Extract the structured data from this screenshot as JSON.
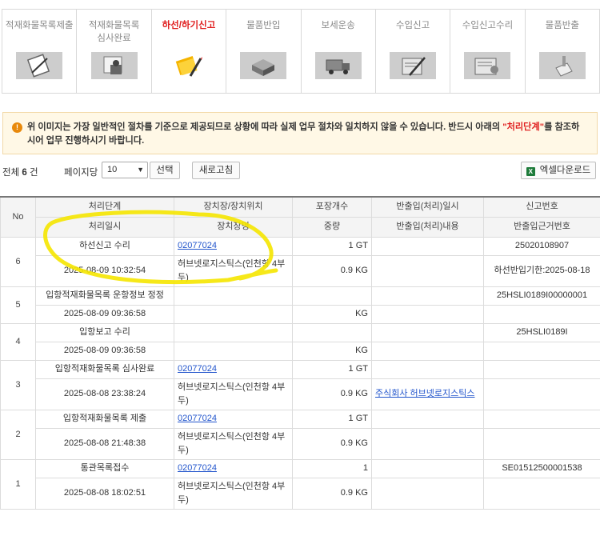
{
  "steps": [
    {
      "label": "적재화물목록제출",
      "icon": "clipboard-pen-icon",
      "active": false
    },
    {
      "label": "적재화물목록\n심사완료",
      "icon": "stamp-document-icon",
      "active": false
    },
    {
      "label": "하선/하기신고",
      "icon": "folder-pencil-icon",
      "active": true
    },
    {
      "label": "물품반입",
      "icon": "boxes-icon",
      "active": false
    },
    {
      "label": "보세운송",
      "icon": "truck-icon",
      "active": false
    },
    {
      "label": "수입신고",
      "icon": "form-pen-icon",
      "active": false
    },
    {
      "label": "수입신고수리",
      "icon": "stamped-form-icon",
      "active": false
    },
    {
      "label": "물품반출",
      "icon": "outgoing-item-icon",
      "active": false
    }
  ],
  "notice": {
    "icon": "exclamation-icon",
    "text_before": "위 이미지는 가장 일반적인 절차를 기준으로 제공되므로 상황에 따라 실제 업무 절차와 일치하지 않을 수 있습니다. 반드시 아래의 ",
    "highlight": "\"처리단계\"",
    "text_after": "를 참조하시어 업무 진행하시기 바랍니다."
  },
  "toolbar": {
    "total_prefix": "전체",
    "total_count": "6",
    "total_suffix": "건",
    "per_page_label": "페이지당",
    "per_page_value": "10",
    "select_label": "선택",
    "refresh_label": "새로고침",
    "excel_label": "엑셀다운로드",
    "excel_icon": "excel-icon"
  },
  "table": {
    "headers": {
      "no": "No",
      "row1": [
        "처리단계",
        "장치장/장치위치",
        "포장개수",
        "반출입(처리)일시",
        "신고번호"
      ],
      "row2": [
        "처리일시",
        "장치장명",
        "중량",
        "반출입(처리)내용",
        "반출입근거번호"
      ]
    },
    "rows": [
      {
        "no": "6",
        "step": "하선신고 수리",
        "location": "02077024",
        "pkg": "1 GT",
        "inout_time": "",
        "decl_no": "25020108907",
        "time": "2025-08-09 10:32:54",
        "location_name": "허브넷로지스틱스(인천항 4부두)",
        "weight": "0.9 KG",
        "inout_content": "",
        "basis_no": "하선반입기한:2025-08-18"
      },
      {
        "no": "5",
        "step": "입항적재화물목록 운항정보 정정",
        "location": "",
        "pkg": "",
        "inout_time": "",
        "decl_no": "25HSLI0189I00000001",
        "time": "2025-08-09 09:36:58",
        "location_name": "",
        "weight": "KG",
        "inout_content": "",
        "basis_no": ""
      },
      {
        "no": "4",
        "step": "입항보고 수리",
        "location": "",
        "pkg": "",
        "inout_time": "",
        "decl_no": "25HSLI0189I",
        "time": "2025-08-09 09:36:58",
        "location_name": "",
        "weight": "KG",
        "inout_content": "",
        "basis_no": ""
      },
      {
        "no": "3",
        "step": "입항적재화물목록 심사완료",
        "location": "02077024",
        "pkg": "1 GT",
        "inout_time": "",
        "decl_no": "",
        "time": "2025-08-08 23:38:24",
        "location_name": "허브넷로지스틱스(인천항 4부두)",
        "weight": "0.9 KG",
        "inout_content": "주식회사 허브넷로지스틱스",
        "basis_no": ""
      },
      {
        "no": "2",
        "step": "입항적재화물목록 제출",
        "location": "02077024",
        "pkg": "1 GT",
        "inout_time": "",
        "decl_no": "",
        "time": "2025-08-08 21:48:38",
        "location_name": "허브넷로지스틱스(인천항 4부두)",
        "weight": "0.9 KG",
        "inout_content": "",
        "basis_no": ""
      },
      {
        "no": "1",
        "step": "통관목록접수",
        "location": "02077024",
        "pkg": "1",
        "inout_time": "",
        "decl_no": "SE01512500001538",
        "time": "2025-08-08 18:02:51",
        "location_name": "허브넷로지스틱스(인천항 4부두)",
        "weight": "0.9 KG",
        "inout_content": "",
        "basis_no": ""
      }
    ]
  },
  "colors": {
    "active_step": "#e02020",
    "notice_bg": "#fff8e6",
    "link": "#2255cc",
    "highlighter": "#f5e600"
  }
}
